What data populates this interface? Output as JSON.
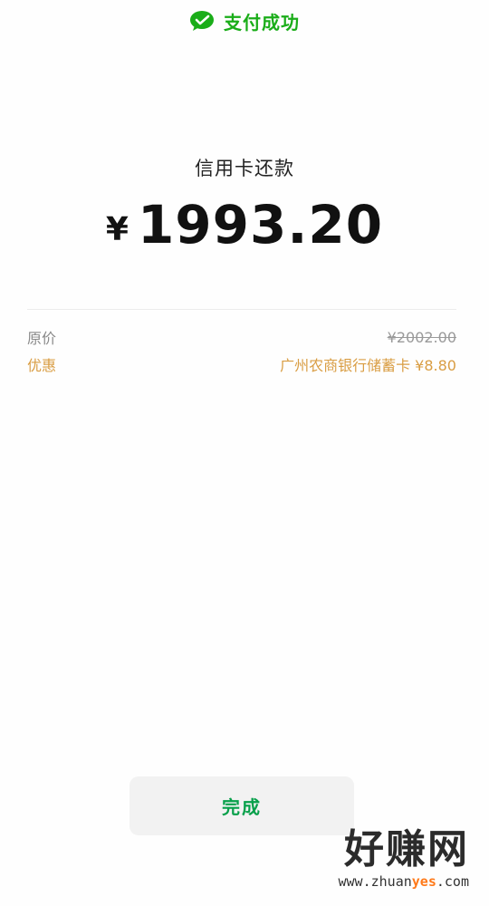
{
  "header": {
    "title": "支付成功",
    "icon": "wechat-pay-icon",
    "color": "#1aad19"
  },
  "payment": {
    "purpose": "信用卡还款",
    "currency_symbol": "¥",
    "amount": "1993.20"
  },
  "details": {
    "original_label": "原价",
    "original_value": "¥2002.00",
    "discount_label": "优惠",
    "discount_value": "广州农商银行储蓄卡 ¥8.80",
    "discount_color": "#d99d43"
  },
  "actions": {
    "done_label": "完成",
    "done_color": "#07a04a"
  },
  "watermark": {
    "name": "好赚网",
    "domain_prefix": "www.zhuan",
    "domain_accent": "yes",
    "domain_suffix": ".com"
  }
}
